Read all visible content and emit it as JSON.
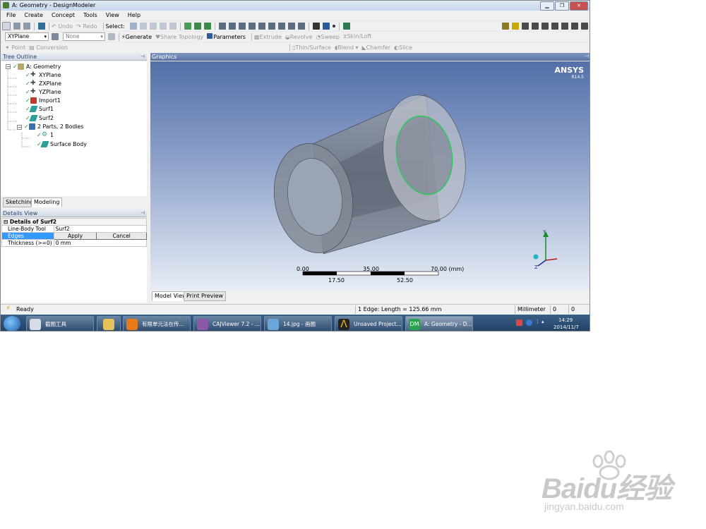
{
  "window": {
    "title": "A: Geometry - DesignModeler"
  },
  "menu": [
    "File",
    "Create",
    "Concept",
    "Tools",
    "View",
    "Help"
  ],
  "toolbar1": {
    "undo": "Undo",
    "redo": "Redo",
    "select": "Select:"
  },
  "toolbar2": {
    "plane": "XYPlane",
    "sketch": "None",
    "generate": "Generate",
    "share_topology": "Share Topology",
    "parameters": "Parameters",
    "extrude": "Extrude",
    "revolve": "Revolve",
    "sweep": "Sweep",
    "skin_loft": "Skin/Loft"
  },
  "toolbar3": {
    "point": "Point",
    "conversion": "Conversion",
    "thin_surface": "Thin/Surface",
    "blend": "Blend",
    "chamfer": "Chamfer",
    "slice": "Slice"
  },
  "tree": {
    "header": "Tree Outline",
    "root": "A: Geometry",
    "items": [
      "XYPlane",
      "ZXPlane",
      "YZPlane",
      "Import1",
      "Surf1",
      "Surf2"
    ],
    "parts": "2 Parts, 2 Bodies",
    "part1": "1",
    "part2": "Surface Body"
  },
  "tabs": {
    "sketching": "Sketching",
    "modeling": "Modeling"
  },
  "details": {
    "header": "Details View",
    "title": "Details of Surf2",
    "rows": [
      {
        "label": "Line-Body Tool",
        "value": "Surf2"
      },
      {
        "label": "Edges",
        "apply": "Apply",
        "cancel": "Cancel"
      },
      {
        "label": "Thickness (>=0)",
        "value": "0 mm"
      }
    ]
  },
  "graphics": {
    "header": "Graphics",
    "brand": "ANSYS",
    "version": "R14.5",
    "scale_top": [
      "0.00",
      "35.00",
      "70.00 (mm)"
    ],
    "scale_bottom": [
      "17.50",
      "52.50"
    ],
    "axis_y": "Y",
    "axis_z": "Z",
    "view_tabs": [
      "Model View",
      "Print Preview"
    ]
  },
  "status": {
    "state": "Ready",
    "selection": "1 Edge: Length = 125.66 mm",
    "units": "Millimeter",
    "v1": "0",
    "v2": "0"
  },
  "taskbar": {
    "items": [
      "截图工具",
      "",
      "有限单元法在传...",
      "CAJViewer 7.2 - ...",
      "14.jpg - 画图",
      "Unsaved Project...",
      "A: Geometry - D..."
    ],
    "time": "14:29",
    "date": "2014/11/7"
  },
  "watermark": {
    "brand": "Baidu经验",
    "url": "jingyan.baidu.com"
  },
  "colors": {
    "accent": "#3399ff",
    "check": "#1c8a2c",
    "bg_top": "#5470a8",
    "bg_bottom": "#e8edf6"
  }
}
